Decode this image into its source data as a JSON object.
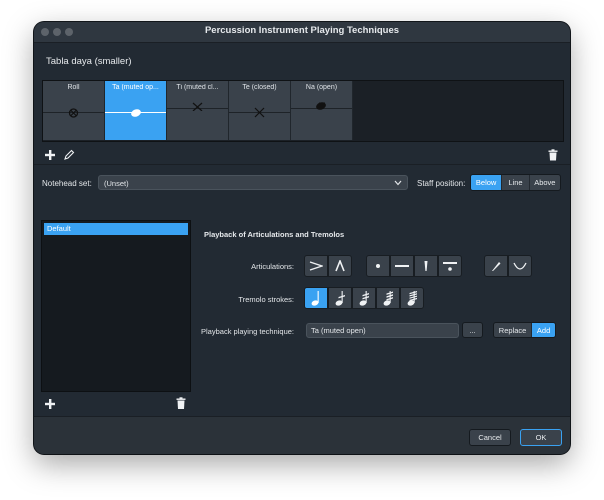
{
  "window": {
    "title": "Percussion Instrument Playing Techniques"
  },
  "instrument": {
    "name": "Tabla daya (smaller)"
  },
  "techniques": [
    {
      "label": "Roll",
      "icon": "roll-notehead-icon",
      "selected": false
    },
    {
      "label": "Ta (muted op...",
      "icon": "open-notehead-icon",
      "selected": true
    },
    {
      "label": "Ti (muted cl...",
      "icon": "x-notehead-icon",
      "selected": false
    },
    {
      "label": "Te (closed)",
      "icon": "x-notehead-icon",
      "selected": false
    },
    {
      "label": "Na (open)",
      "icon": "filled-notehead-icon",
      "selected": false
    }
  ],
  "notehead": {
    "label": "Notehead set:",
    "value": "(Unset)"
  },
  "staff_position": {
    "label": "Staff position:",
    "options": [
      "Below",
      "Line",
      "Above"
    ],
    "selected": "Below"
  },
  "list": {
    "items": [
      "Default"
    ]
  },
  "playback": {
    "section_title": "Playback of Articulations and Tremolos",
    "articulations_label": "Articulations:",
    "tremolo_label": "Tremolo strokes:",
    "technique_label": "Playback playing technique:",
    "technique_value": "Ta (muted open)",
    "ellipsis": "...",
    "replace": "Replace",
    "add": "Add"
  },
  "footer": {
    "cancel": "Cancel",
    "ok": "OK"
  },
  "colors": {
    "accent": "#3aa2f2",
    "window_bg": "#222a33"
  }
}
